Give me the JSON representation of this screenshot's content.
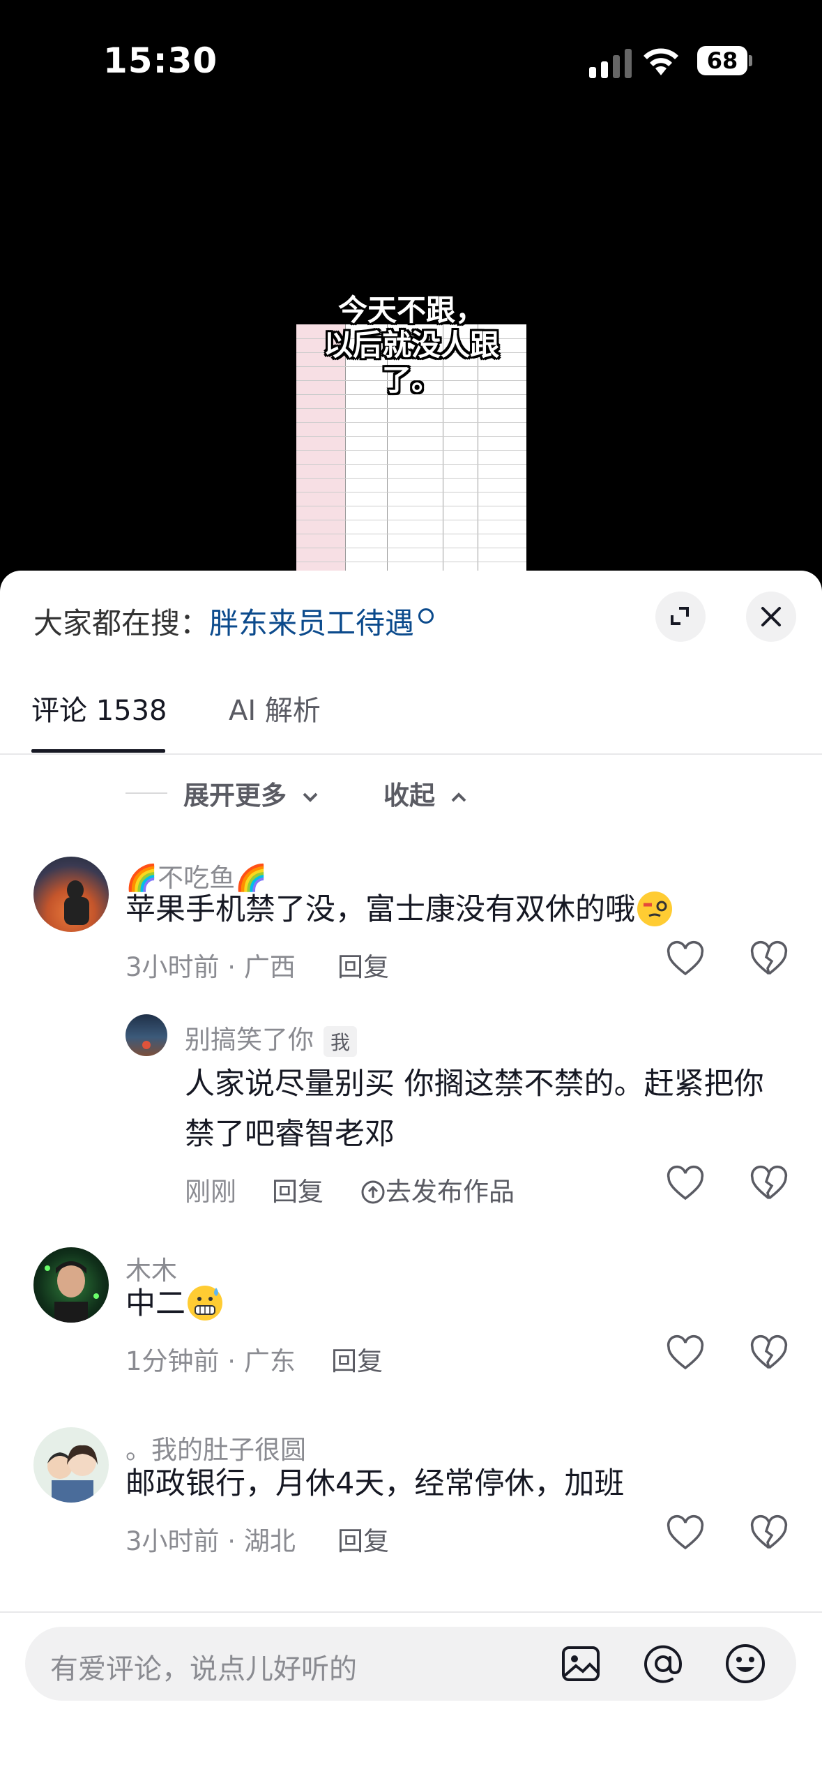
{
  "status_bar": {
    "time": "15:30",
    "battery": "68"
  },
  "video": {
    "caption_line1": "今天不跟，",
    "caption_line2": "以后就没人跟了。"
  },
  "search_suggest": {
    "prefix": "大家都在搜：",
    "keyword": "胖东来员工待遇"
  },
  "tabs": [
    {
      "label": "评论 1538",
      "active": true
    },
    {
      "label": "AI 解析",
      "active": false
    }
  ],
  "thread_controls": {
    "expand_more": "展开更多",
    "collapse": "收起"
  },
  "comments": [
    {
      "username": "🌈不吃鱼🌈",
      "text": "苹果手机禁了没，富士康没有双休的哦",
      "meta": "3小时前 · 广西",
      "reply_label": "回复",
      "reply": {
        "username": "别搞笑了你",
        "badge": "我",
        "text_line1": "人家说尽量别买 你搁这禁不禁的。赶紧把你",
        "text_line2": "禁了吧睿智老邓",
        "time": "刚刚",
        "reply_label": "回复",
        "publish_label": "去发布作品"
      }
    },
    {
      "username": "木木",
      "text": "中二",
      "meta": "1分钟前 · 广东",
      "reply_label": "回复"
    },
    {
      "username": "。我的肚子很圆",
      "text": "邮政银行，月休4天，经常停休，加班",
      "meta": "3小时前 · 湖北",
      "reply_label": "回复"
    }
  ],
  "input_bar": {
    "placeholder": "有爱评论，说点儿好听的"
  },
  "colors": {
    "link_blue": "#0b4a8c",
    "text_primary": "#161823",
    "text_secondary": "#8a8b91"
  },
  "icons": [
    "search-icon",
    "expand-icon",
    "close-icon",
    "heart-icon",
    "broken-heart-icon",
    "image-icon",
    "at-icon",
    "emoji-icon"
  ]
}
